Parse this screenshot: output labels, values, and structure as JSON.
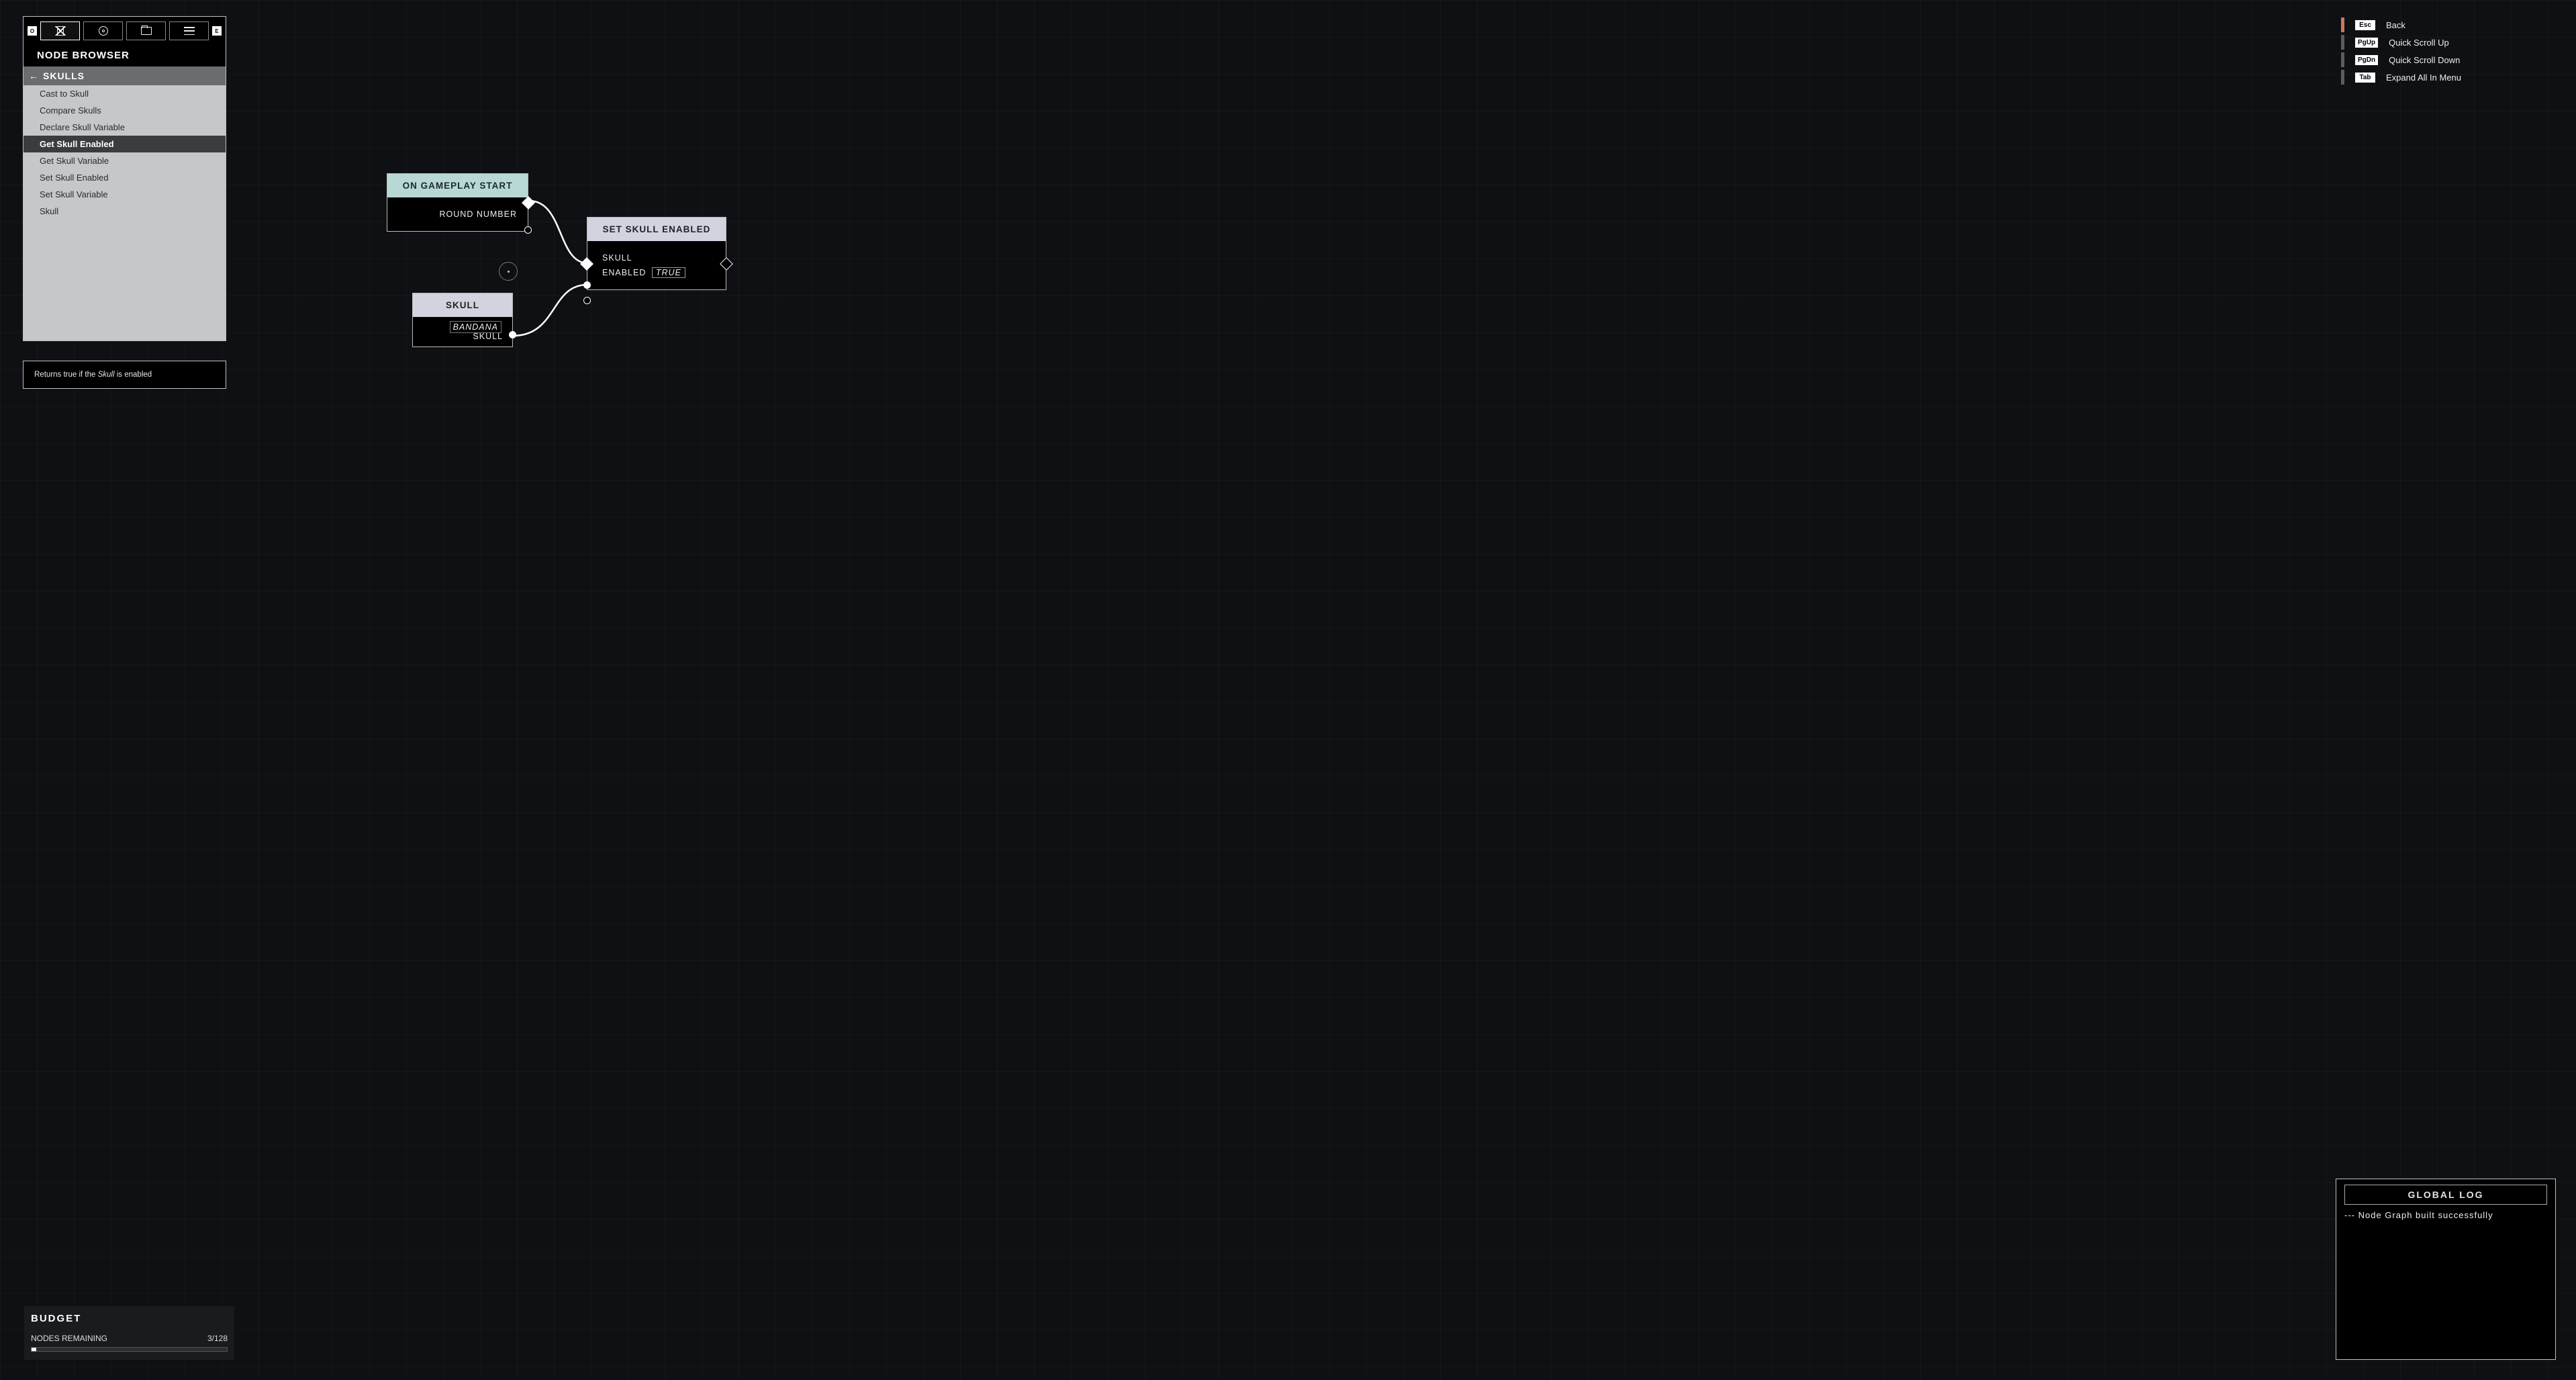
{
  "browser": {
    "title": "NODE BROWSER",
    "left_pill": "O",
    "right_pill": "E",
    "category": "SKULLS",
    "items": [
      "Cast to Skull",
      "Compare Skulls",
      "Declare Skull Variable",
      "Get Skull Enabled",
      "Get Skull Variable",
      "Set Skull Enabled",
      "Set Skull Variable",
      "Skull"
    ],
    "selected_index": 3,
    "description_pre": "Returns true if the ",
    "description_em": "Skull",
    "description_post": " is enabled"
  },
  "budget": {
    "title": "BUDGET",
    "row_label": "NODES REMAINING",
    "row_value": "3/128",
    "fill_pct": 2.5
  },
  "hotkeys": [
    {
      "key": "Esc",
      "label": "Back",
      "accent": true
    },
    {
      "key": "PgUp",
      "label": "Quick Scroll Up",
      "accent": false
    },
    {
      "key": "PgDn",
      "label": "Quick Scroll Down",
      "accent": false
    },
    {
      "key": "Tab",
      "label": "Expand All In Menu",
      "accent": false
    }
  ],
  "log": {
    "title": "GLOBAL LOG",
    "line": "--- Node Graph built successfully"
  },
  "graph": {
    "node1": {
      "title": "ON GAMEPLAY START",
      "out": "ROUND NUMBER"
    },
    "node2": {
      "title": "SKULL",
      "out_param": "BANDANA",
      "out_label": "SKULL"
    },
    "node3": {
      "title": "SET SKULL ENABLED",
      "in1": "SKULL",
      "in2_label": "ENABLED",
      "in2_value": "TRUE"
    }
  }
}
